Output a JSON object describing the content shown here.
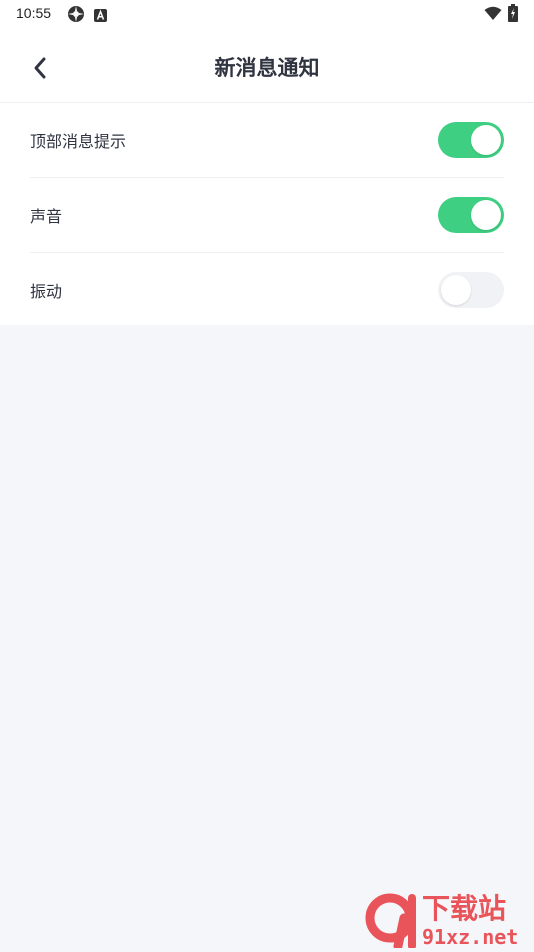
{
  "status_bar": {
    "time": "10:55",
    "icons": [
      "gear-notification-icon",
      "a-badge-icon",
      "wifi-icon",
      "battery-charging-icon"
    ]
  },
  "header": {
    "back_icon": "chevron-left-icon",
    "title": "新消息通知"
  },
  "settings": [
    {
      "label": "顶部消息提示",
      "enabled": true
    },
    {
      "label": "声音",
      "enabled": true
    },
    {
      "label": "振动",
      "enabled": false
    }
  ],
  "colors": {
    "switch_on": "#3ecf82",
    "switch_off": "#f1f2f5",
    "page_bg": "#f5f6f9",
    "text": "#2f3440"
  },
  "watermark": {
    "brand": "下载站",
    "domain": "91xz.net",
    "logo_text": "91"
  }
}
